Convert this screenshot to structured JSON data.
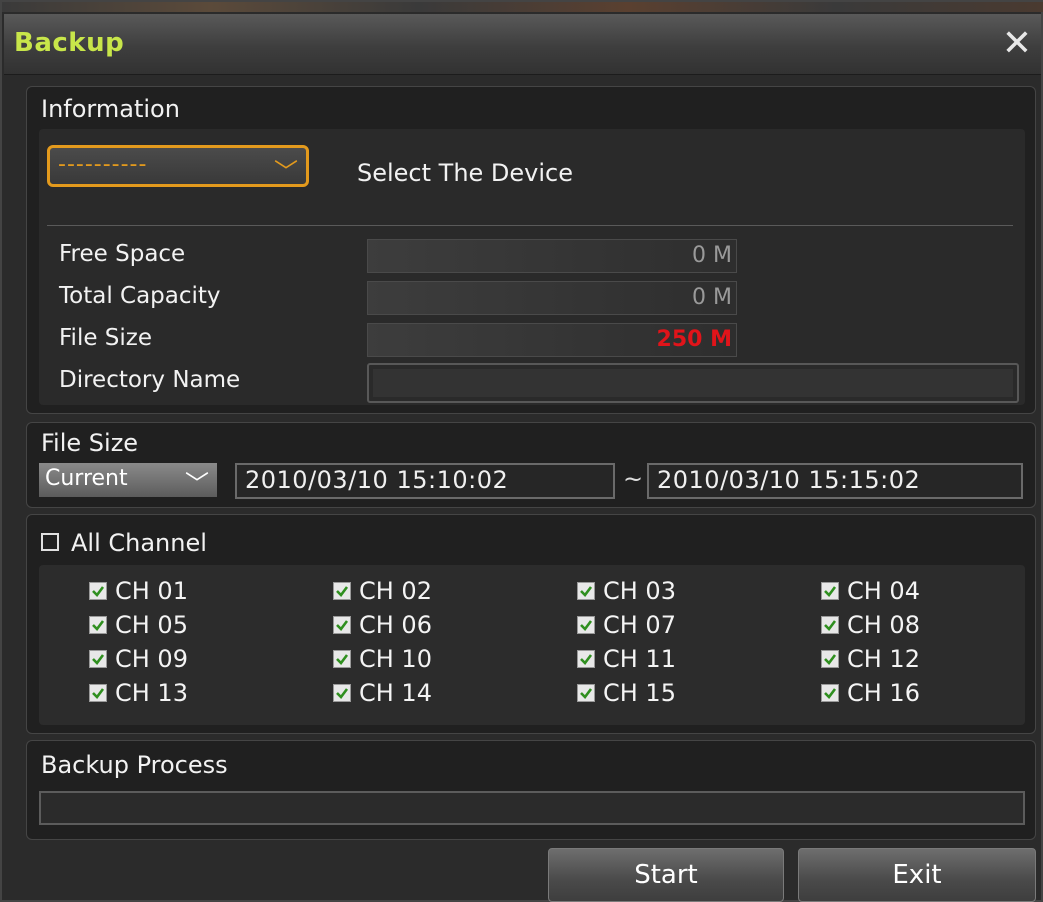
{
  "window": {
    "title": "Backup",
    "close_symbol": "✕"
  },
  "information": {
    "title": "Information",
    "device_select": {
      "value": "----------",
      "chevron": "﹀"
    },
    "select_device_label": "Select The Device",
    "free_space": {
      "label": "Free Space",
      "value": "0 M"
    },
    "total_capacity": {
      "label": "Total Capacity",
      "value": "0 M"
    },
    "file_size": {
      "label": "File Size",
      "value": "250 M",
      "value_color": "#e1141a"
    },
    "directory_name": {
      "label": "Directory Name",
      "value": ""
    }
  },
  "file_size_section": {
    "title": "File Size",
    "range_select": {
      "value": "Current",
      "chevron": "﹀"
    },
    "start": "2010/03/10  15:10:02",
    "separator": "~",
    "end": "2010/03/10  15:15:02"
  },
  "channels": {
    "all_label": "All Channel",
    "all_checked": false,
    "items": [
      {
        "label": "CH 01",
        "checked": true
      },
      {
        "label": "CH 02",
        "checked": true
      },
      {
        "label": "CH 03",
        "checked": true
      },
      {
        "label": "CH 04",
        "checked": true
      },
      {
        "label": "CH 05",
        "checked": true
      },
      {
        "label": "CH 06",
        "checked": true
      },
      {
        "label": "CH 07",
        "checked": true
      },
      {
        "label": "CH 08",
        "checked": true
      },
      {
        "label": "CH 09",
        "checked": true
      },
      {
        "label": "CH 10",
        "checked": true
      },
      {
        "label": "CH 11",
        "checked": true
      },
      {
        "label": "CH 12",
        "checked": true
      },
      {
        "label": "CH 13",
        "checked": true
      },
      {
        "label": "CH 14",
        "checked": true
      },
      {
        "label": "CH 15",
        "checked": true
      },
      {
        "label": "CH 16",
        "checked": true
      }
    ]
  },
  "backup_process": {
    "title": "Backup Process",
    "progress": 0
  },
  "buttons": {
    "start": "Start",
    "exit": "Exit"
  },
  "colors": {
    "title_text": "#c8e64a",
    "focus_orange": "#e39a1d",
    "checkbox_green": "#2f8f1f"
  }
}
